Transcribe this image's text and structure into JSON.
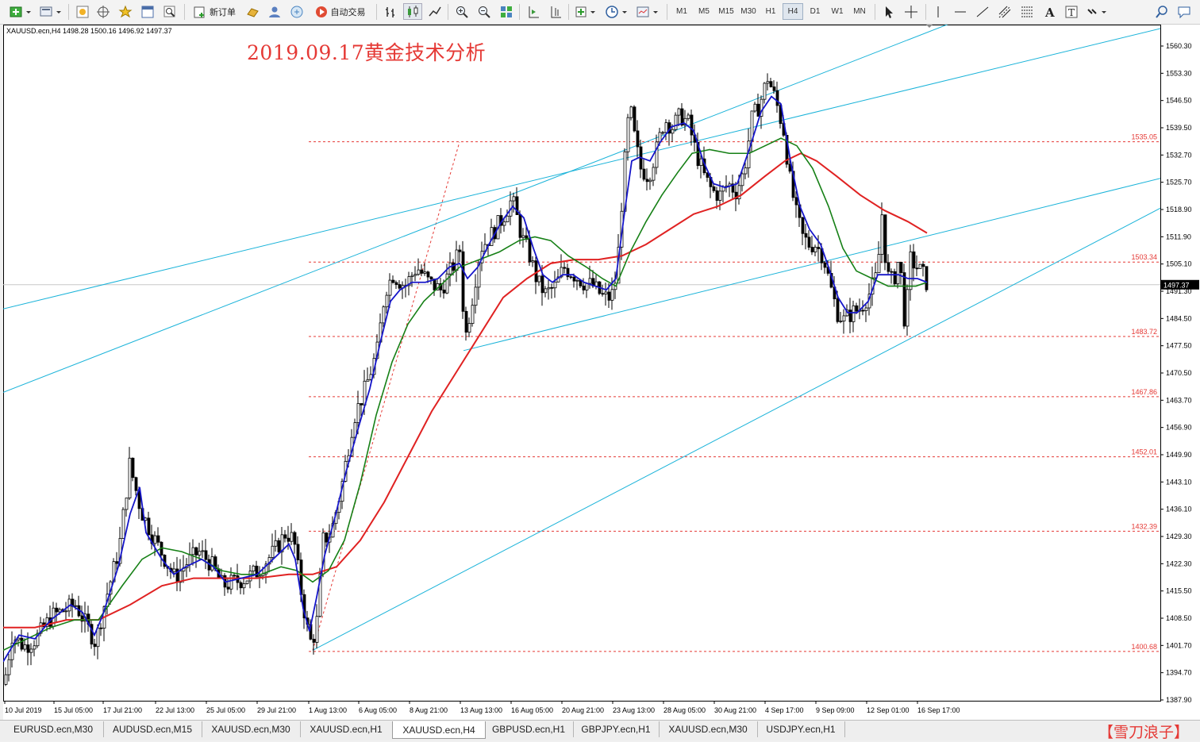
{
  "toolbar": {
    "new_order_label": "新订单",
    "auto_trade_label": "自动交易",
    "timeframes": [
      "M1",
      "M5",
      "M15",
      "M30",
      "H1",
      "H4",
      "D1",
      "W1",
      "MN"
    ],
    "active_timeframe": "H4"
  },
  "chart": {
    "symbol_info": "XAUUSD.ecn,H4  1498.28 1500.16 1496.92 1497.37",
    "title": "2019.09.17黄金技术分析",
    "current_price": "1497.37",
    "colors": {
      "blue_ma": "#1515c9",
      "green_ma": "#168016",
      "red_ma": "#e02222",
      "channel": "#1ab3d9",
      "levels": "#e53935",
      "bg": "#ffffff",
      "price_tag_bg": "#000000"
    }
  },
  "chart_data": {
    "type": "candlestick",
    "symbol": "XAUUSD.ecn",
    "timeframe": "H4",
    "ohlc_last": {
      "open": 1498.28,
      "high": 1500.16,
      "low": 1496.92,
      "close": 1497.37
    },
    "y_ticks": [
      "1560.30",
      "1553.30",
      "1546.50",
      "1539.50",
      "1532.70",
      "1525.70",
      "1518.90",
      "1511.90",
      "1505.10",
      "1491.30",
      "1484.50",
      "1477.50",
      "1470.50",
      "1463.70",
      "1456.90",
      "1449.90",
      "1443.10",
      "1436.10",
      "1429.30",
      "1422.30",
      "1415.50",
      "1408.50",
      "1401.70",
      "1394.70",
      "1387.90"
    ],
    "x_ticks": [
      "10 Jul 2019",
      "15 Jul 05:00",
      "17 Jul 21:00",
      "22 Jul 13:00",
      "25 Jul 05:00",
      "29 Jul 21:00",
      "1 Aug 13:00",
      "6 Aug 05:00",
      "8 Aug 21:00",
      "13 Aug 13:00",
      "16 Aug 05:00",
      "20 Aug 21:00",
      "23 Aug 13:00",
      "28 Aug 05:00",
      "30 Aug 21:00",
      "4 Sep 17:00",
      "9 Sep 09:00",
      "12 Sep 01:00",
      "16 Sep 17:00"
    ],
    "levels": [
      {
        "price": 1535.05,
        "label": "1535.05"
      },
      {
        "price": 1503.34,
        "label": "1503.34"
      },
      {
        "price": 1483.72,
        "label": "1483.72"
      },
      {
        "price": 1467.86,
        "label": "1467.86"
      },
      {
        "price": 1452.01,
        "label": "1452.01"
      },
      {
        "price": 1432.39,
        "label": "1432.39"
      },
      {
        "price": 1400.68,
        "label": "1400.68"
      }
    ],
    "price_path": [
      [
        0,
        1392
      ],
      [
        10,
        1405
      ],
      [
        25,
        1402
      ],
      [
        40,
        1404
      ],
      [
        60,
        1410
      ],
      [
        90,
        1413
      ],
      [
        115,
        1403
      ],
      [
        125,
        1412
      ],
      [
        145,
        1428
      ],
      [
        158,
        1450
      ],
      [
        172,
        1438
      ],
      [
        185,
        1432
      ],
      [
        200,
        1426
      ],
      [
        215,
        1420
      ],
      [
        230,
        1424
      ],
      [
        245,
        1427
      ],
      [
        260,
        1424
      ],
      [
        275,
        1418
      ],
      [
        290,
        1419
      ],
      [
        305,
        1420
      ],
      [
        320,
        1422
      ],
      [
        340,
        1427
      ],
      [
        355,
        1432
      ],
      [
        365,
        1430
      ],
      [
        375,
        1415
      ],
      [
        385,
        1403
      ],
      [
        393,
        1406
      ],
      [
        402,
        1430
      ],
      [
        412,
        1432
      ],
      [
        425,
        1444
      ],
      [
        440,
        1462
      ],
      [
        455,
        1470
      ],
      [
        470,
        1480
      ],
      [
        480,
        1496
      ],
      [
        490,
        1500
      ],
      [
        505,
        1497
      ],
      [
        520,
        1502
      ],
      [
        535,
        1498
      ],
      [
        550,
        1496
      ],
      [
        565,
        1502
      ],
      [
        575,
        1507
      ],
      [
        580,
        1482
      ],
      [
        590,
        1494
      ],
      [
        600,
        1507
      ],
      [
        612,
        1510
      ],
      [
        628,
        1515
      ],
      [
        640,
        1520
      ],
      [
        652,
        1510
      ],
      [
        662,
        1505
      ],
      [
        672,
        1498
      ],
      [
        682,
        1495
      ],
      [
        695,
        1497
      ],
      [
        705,
        1502
      ],
      [
        718,
        1500
      ],
      [
        730,
        1498
      ],
      [
        742,
        1497
      ],
      [
        755,
        1494
      ],
      [
        765,
        1494
      ],
      [
        772,
        1500
      ],
      [
        780,
        1525
      ],
      [
        788,
        1545
      ],
      [
        795,
        1535
      ],
      [
        802,
        1528
      ],
      [
        812,
        1526
      ],
      [
        822,
        1533
      ],
      [
        832,
        1541
      ],
      [
        842,
        1539
      ],
      [
        852,
        1542
      ],
      [
        862,
        1540
      ],
      [
        872,
        1532
      ],
      [
        882,
        1526
      ],
      [
        892,
        1522
      ],
      [
        902,
        1521
      ],
      [
        912,
        1524
      ],
      [
        922,
        1522
      ],
      [
        932,
        1527
      ],
      [
        942,
        1541
      ],
      [
        952,
        1545
      ],
      [
        962,
        1552
      ],
      [
        972,
        1546
      ],
      [
        982,
        1538
      ],
      [
        990,
        1525
      ],
      [
        998,
        1516
      ],
      [
        1006,
        1510
      ],
      [
        1014,
        1508
      ],
      [
        1022,
        1508
      ],
      [
        1032,
        1505
      ],
      [
        1042,
        1496
      ],
      [
        1050,
        1490
      ],
      [
        1058,
        1488
      ],
      [
        1068,
        1490
      ],
      [
        1078,
        1491
      ],
      [
        1090,
        1495
      ],
      [
        1100,
        1500
      ],
      [
        1106,
        1516
      ],
      [
        1112,
        1500
      ],
      [
        1120,
        1498
      ],
      [
        1128,
        1505
      ],
      [
        1135,
        1486
      ],
      [
        1142,
        1504
      ],
      [
        1150,
        1502
      ],
      [
        1158,
        1500
      ],
      [
        1164,
        1497
      ]
    ],
    "ma_blue": [
      [
        0,
        1398
      ],
      [
        20,
        1405
      ],
      [
        40,
        1404
      ],
      [
        60,
        1409
      ],
      [
        85,
        1413
      ],
      [
        100,
        1411
      ],
      [
        115,
        1405
      ],
      [
        125,
        1410
      ],
      [
        145,
        1423
      ],
      [
        160,
        1437
      ],
      [
        172,
        1444
      ],
      [
        180,
        1432
      ],
      [
        200,
        1425
      ],
      [
        215,
        1421
      ],
      [
        230,
        1423
      ],
      [
        250,
        1425
      ],
      [
        265,
        1423
      ],
      [
        280,
        1419
      ],
      [
        300,
        1420
      ],
      [
        320,
        1421
      ],
      [
        340,
        1425
      ],
      [
        360,
        1429
      ],
      [
        368,
        1425
      ],
      [
        378,
        1412
      ],
      [
        386,
        1406
      ],
      [
        395,
        1415
      ],
      [
        405,
        1426
      ],
      [
        418,
        1436
      ],
      [
        432,
        1448
      ],
      [
        448,
        1460
      ],
      [
        462,
        1470
      ],
      [
        475,
        1482
      ],
      [
        488,
        1493
      ],
      [
        500,
        1496
      ],
      [
        515,
        1498
      ],
      [
        532,
        1498
      ],
      [
        548,
        1499
      ],
      [
        562,
        1502
      ],
      [
        575,
        1503
      ],
      [
        585,
        1499
      ],
      [
        598,
        1502
      ],
      [
        612,
        1508
      ],
      [
        628,
        1514
      ],
      [
        642,
        1518
      ],
      [
        656,
        1515
      ],
      [
        668,
        1507
      ],
      [
        680,
        1500
      ],
      [
        692,
        1498
      ],
      [
        705,
        1500
      ],
      [
        718,
        1500
      ],
      [
        732,
        1498
      ],
      [
        746,
        1497
      ],
      [
        760,
        1496
      ],
      [
        772,
        1499
      ],
      [
        782,
        1515
      ],
      [
        792,
        1530
      ],
      [
        802,
        1531
      ],
      [
        815,
        1530
      ],
      [
        828,
        1535
      ],
      [
        842,
        1539
      ],
      [
        858,
        1540
      ],
      [
        870,
        1538
      ],
      [
        882,
        1530
      ],
      [
        895,
        1524
      ],
      [
        910,
        1523
      ],
      [
        925,
        1524
      ],
      [
        940,
        1533
      ],
      [
        955,
        1543
      ],
      [
        968,
        1547
      ],
      [
        980,
        1545
      ],
      [
        992,
        1530
      ],
      [
        1004,
        1518
      ],
      [
        1016,
        1512
      ],
      [
        1030,
        1508
      ],
      [
        1040,
        1502
      ],
      [
        1052,
        1494
      ],
      [
        1064,
        1490
      ],
      [
        1076,
        1490
      ],
      [
        1090,
        1493
      ],
      [
        1102,
        1500
      ],
      [
        1115,
        1500
      ],
      [
        1128,
        1500
      ],
      [
        1140,
        1499
      ],
      [
        1152,
        1499
      ],
      [
        1164,
        1498
      ]
    ],
    "ma_green": [
      [
        0,
        1401
      ],
      [
        30,
        1404
      ],
      [
        60,
        1407
      ],
      [
        90,
        1409
      ],
      [
        120,
        1409
      ],
      [
        150,
        1418
      ],
      [
        175,
        1425
      ],
      [
        200,
        1428
      ],
      [
        225,
        1427
      ],
      [
        250,
        1425
      ],
      [
        275,
        1422
      ],
      [
        300,
        1421
      ],
      [
        325,
        1421
      ],
      [
        350,
        1423
      ],
      [
        370,
        1422
      ],
      [
        390,
        1419
      ],
      [
        410,
        1422
      ],
      [
        430,
        1430
      ],
      [
        450,
        1445
      ],
      [
        470,
        1463
      ],
      [
        490,
        1477
      ],
      [
        510,
        1487
      ],
      [
        530,
        1493
      ],
      [
        550,
        1497
      ],
      [
        575,
        1502
      ],
      [
        600,
        1504
      ],
      [
        625,
        1506
      ],
      [
        650,
        1509
      ],
      [
        670,
        1510
      ],
      [
        690,
        1509
      ],
      [
        712,
        1505
      ],
      [
        735,
        1502
      ],
      [
        755,
        1499
      ],
      [
        772,
        1497
      ],
      [
        790,
        1506
      ],
      [
        810,
        1514
      ],
      [
        830,
        1521
      ],
      [
        850,
        1527
      ],
      [
        868,
        1532
      ],
      [
        890,
        1533
      ],
      [
        915,
        1532
      ],
      [
        940,
        1532
      ],
      [
        960,
        1534
      ],
      [
        980,
        1536
      ],
      [
        1000,
        1534
      ],
      [
        1020,
        1528
      ],
      [
        1040,
        1518
      ],
      [
        1058,
        1507
      ],
      [
        1075,
        1501
      ],
      [
        1095,
        1499
      ],
      [
        1115,
        1497
      ],
      [
        1135,
        1497
      ],
      [
        1150,
        1497
      ],
      [
        1164,
        1498
      ]
    ],
    "ma_red": [
      [
        0,
        1407
      ],
      [
        40,
        1407
      ],
      [
        80,
        1409
      ],
      [
        120,
        1409
      ],
      [
        160,
        1413
      ],
      [
        200,
        1418
      ],
      [
        240,
        1420
      ],
      [
        280,
        1420
      ],
      [
        320,
        1420
      ],
      [
        360,
        1421
      ],
      [
        390,
        1421
      ],
      [
        420,
        1423
      ],
      [
        450,
        1430
      ],
      [
        480,
        1440
      ],
      [
        510,
        1452
      ],
      [
        540,
        1464
      ],
      [
        570,
        1474
      ],
      [
        600,
        1484
      ],
      [
        630,
        1494
      ],
      [
        660,
        1499
      ],
      [
        690,
        1503
      ],
      [
        720,
        1504
      ],
      [
        750,
        1504
      ],
      [
        780,
        1505
      ],
      [
        810,
        1508
      ],
      [
        840,
        1512
      ],
      [
        870,
        1516
      ],
      [
        900,
        1518
      ],
      [
        930,
        1521
      ],
      [
        960,
        1526
      ],
      [
        985,
        1530
      ],
      [
        1005,
        1532
      ],
      [
        1025,
        1530
      ],
      [
        1050,
        1526
      ],
      [
        1080,
        1521
      ],
      [
        1110,
        1517
      ],
      [
        1140,
        1514
      ],
      [
        1164,
        1511
      ]
    ],
    "channel_lines": [
      {
        "p1": [
          390,
          1401
        ],
        "p2": [
          1508,
          1523
        ]
      },
      {
        "p1": [
          580,
          1480
        ],
        "p2": [
          1508,
          1528
        ]
      },
      {
        "p1": [
          0,
          1491
        ],
        "p2": [
          1460,
          1565
        ]
      },
      {
        "p1": [
          0,
          1469
        ],
        "p2": [
          1460,
          1588
        ]
      }
    ],
    "dashed_zigzag": [
      [
        390,
        1401
      ],
      [
        575,
        1535
      ]
    ]
  },
  "tabs": [
    "EURUSD.ecn,M30",
    "AUDUSD.ecn,M15",
    "XAUUSD.ecn,M30",
    "XAUUSD.ecn,H1",
    "XAUUSD.ecn,H4",
    "GBPUSD.ecn,H1",
    "GBPJPY.ecn,H1",
    "XAUUSD.ecn,M30",
    "USDJPY.ecn,H1"
  ],
  "active_tab": "XAUUSD.ecn,H4",
  "brand": "【雪刀浪子】"
}
